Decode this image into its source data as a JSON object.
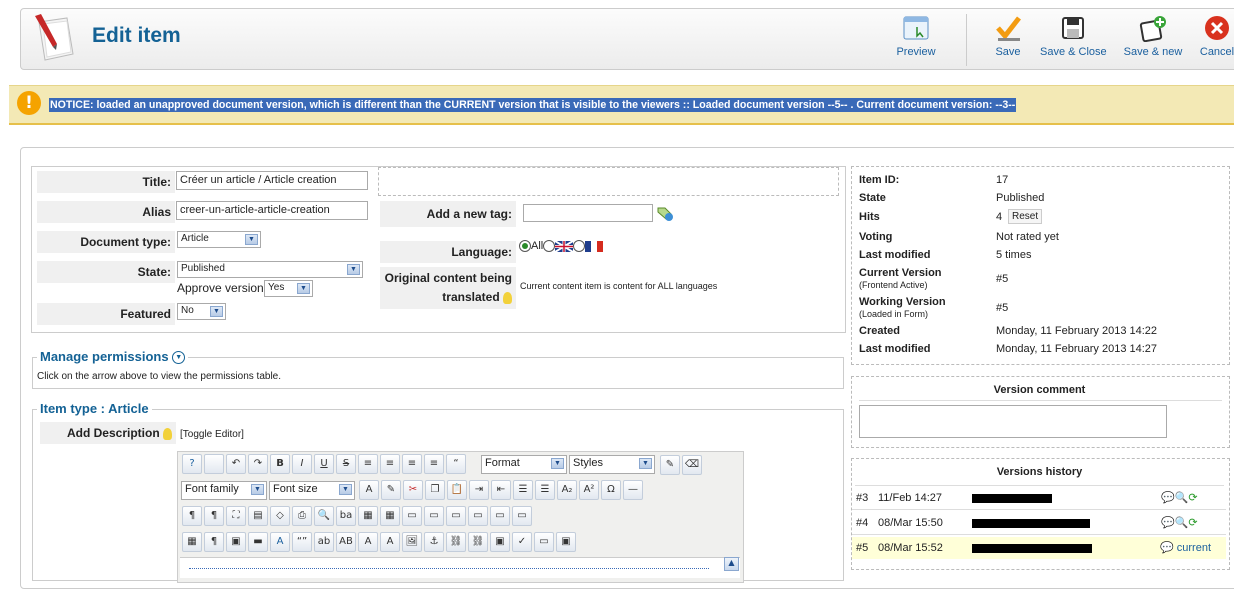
{
  "header": {
    "title": "Edit item"
  },
  "toolbar": {
    "preview": "Preview",
    "save": "Save",
    "save_close": "Save & Close",
    "save_new": "Save & new",
    "cancel": "Cancel"
  },
  "notice": {
    "text": "NOTICE: loaded an unapproved document version, which is different than the CURRENT version that is visible to the viewers :: Loaded document version --5-- . Current document version: --3--"
  },
  "form": {
    "title_label": "Title:",
    "title_value": "Créer un article / Article creation",
    "alias_label": "Alias",
    "alias_value": "creer-un-article-article-creation",
    "doctype_label": "Document type:",
    "doctype_value": "Article",
    "state_label": "State:",
    "state_value": "Published",
    "approve_label": "Approve version",
    "approve_value": "Yes",
    "featured_label": "Featured",
    "featured_value": "No",
    "tag_label": "Add a new tag:",
    "language_label": "Language:",
    "language_all": "All",
    "orig_label_1": "Original content being",
    "orig_label_2": "translated",
    "orig_text": "Current content item is content for ALL languages"
  },
  "permissions": {
    "title": "Manage permissions",
    "hint": "Click on the arrow above to view the permissions table."
  },
  "itemtype": {
    "title": "Item type : Article",
    "desc_label": "Add Description",
    "toggle": "[Toggle Editor]"
  },
  "editor": {
    "format": "Format",
    "styles": "Styles",
    "font_family": "Font family",
    "font_size": "Font size"
  },
  "info": {
    "item_id_k": "Item ID:",
    "item_id_v": "17",
    "state_k": "State",
    "state_v": "Published",
    "hits_k": "Hits",
    "hits_v": "4",
    "reset": "Reset",
    "voting_k": "Voting",
    "voting_v": "Not rated yet",
    "lastmod_k": "Last modified",
    "lastmod_v": "5 times",
    "curver_k": "Current Version",
    "curver_sub": "(Frontend Active)",
    "curver_v": "#5",
    "workver_k": "Working Version",
    "workver_sub": "(Loaded in Form)",
    "workver_v": "#5",
    "created_k": "Created",
    "created_v": "Monday, 11 February 2013 14:22",
    "lastmod2_k": "Last modified",
    "lastmod2_v": "Monday, 11 February 2013 14:27"
  },
  "version_comment": {
    "title": "Version comment"
  },
  "versions": {
    "title": "Versions history",
    "rows": [
      {
        "num": "#3",
        "date": "11/Feb 14:27"
      },
      {
        "num": "#4",
        "date": "08/Mar 15:50"
      },
      {
        "num": "#5",
        "date": "08/Mar 15:52",
        "status": "current"
      }
    ]
  }
}
